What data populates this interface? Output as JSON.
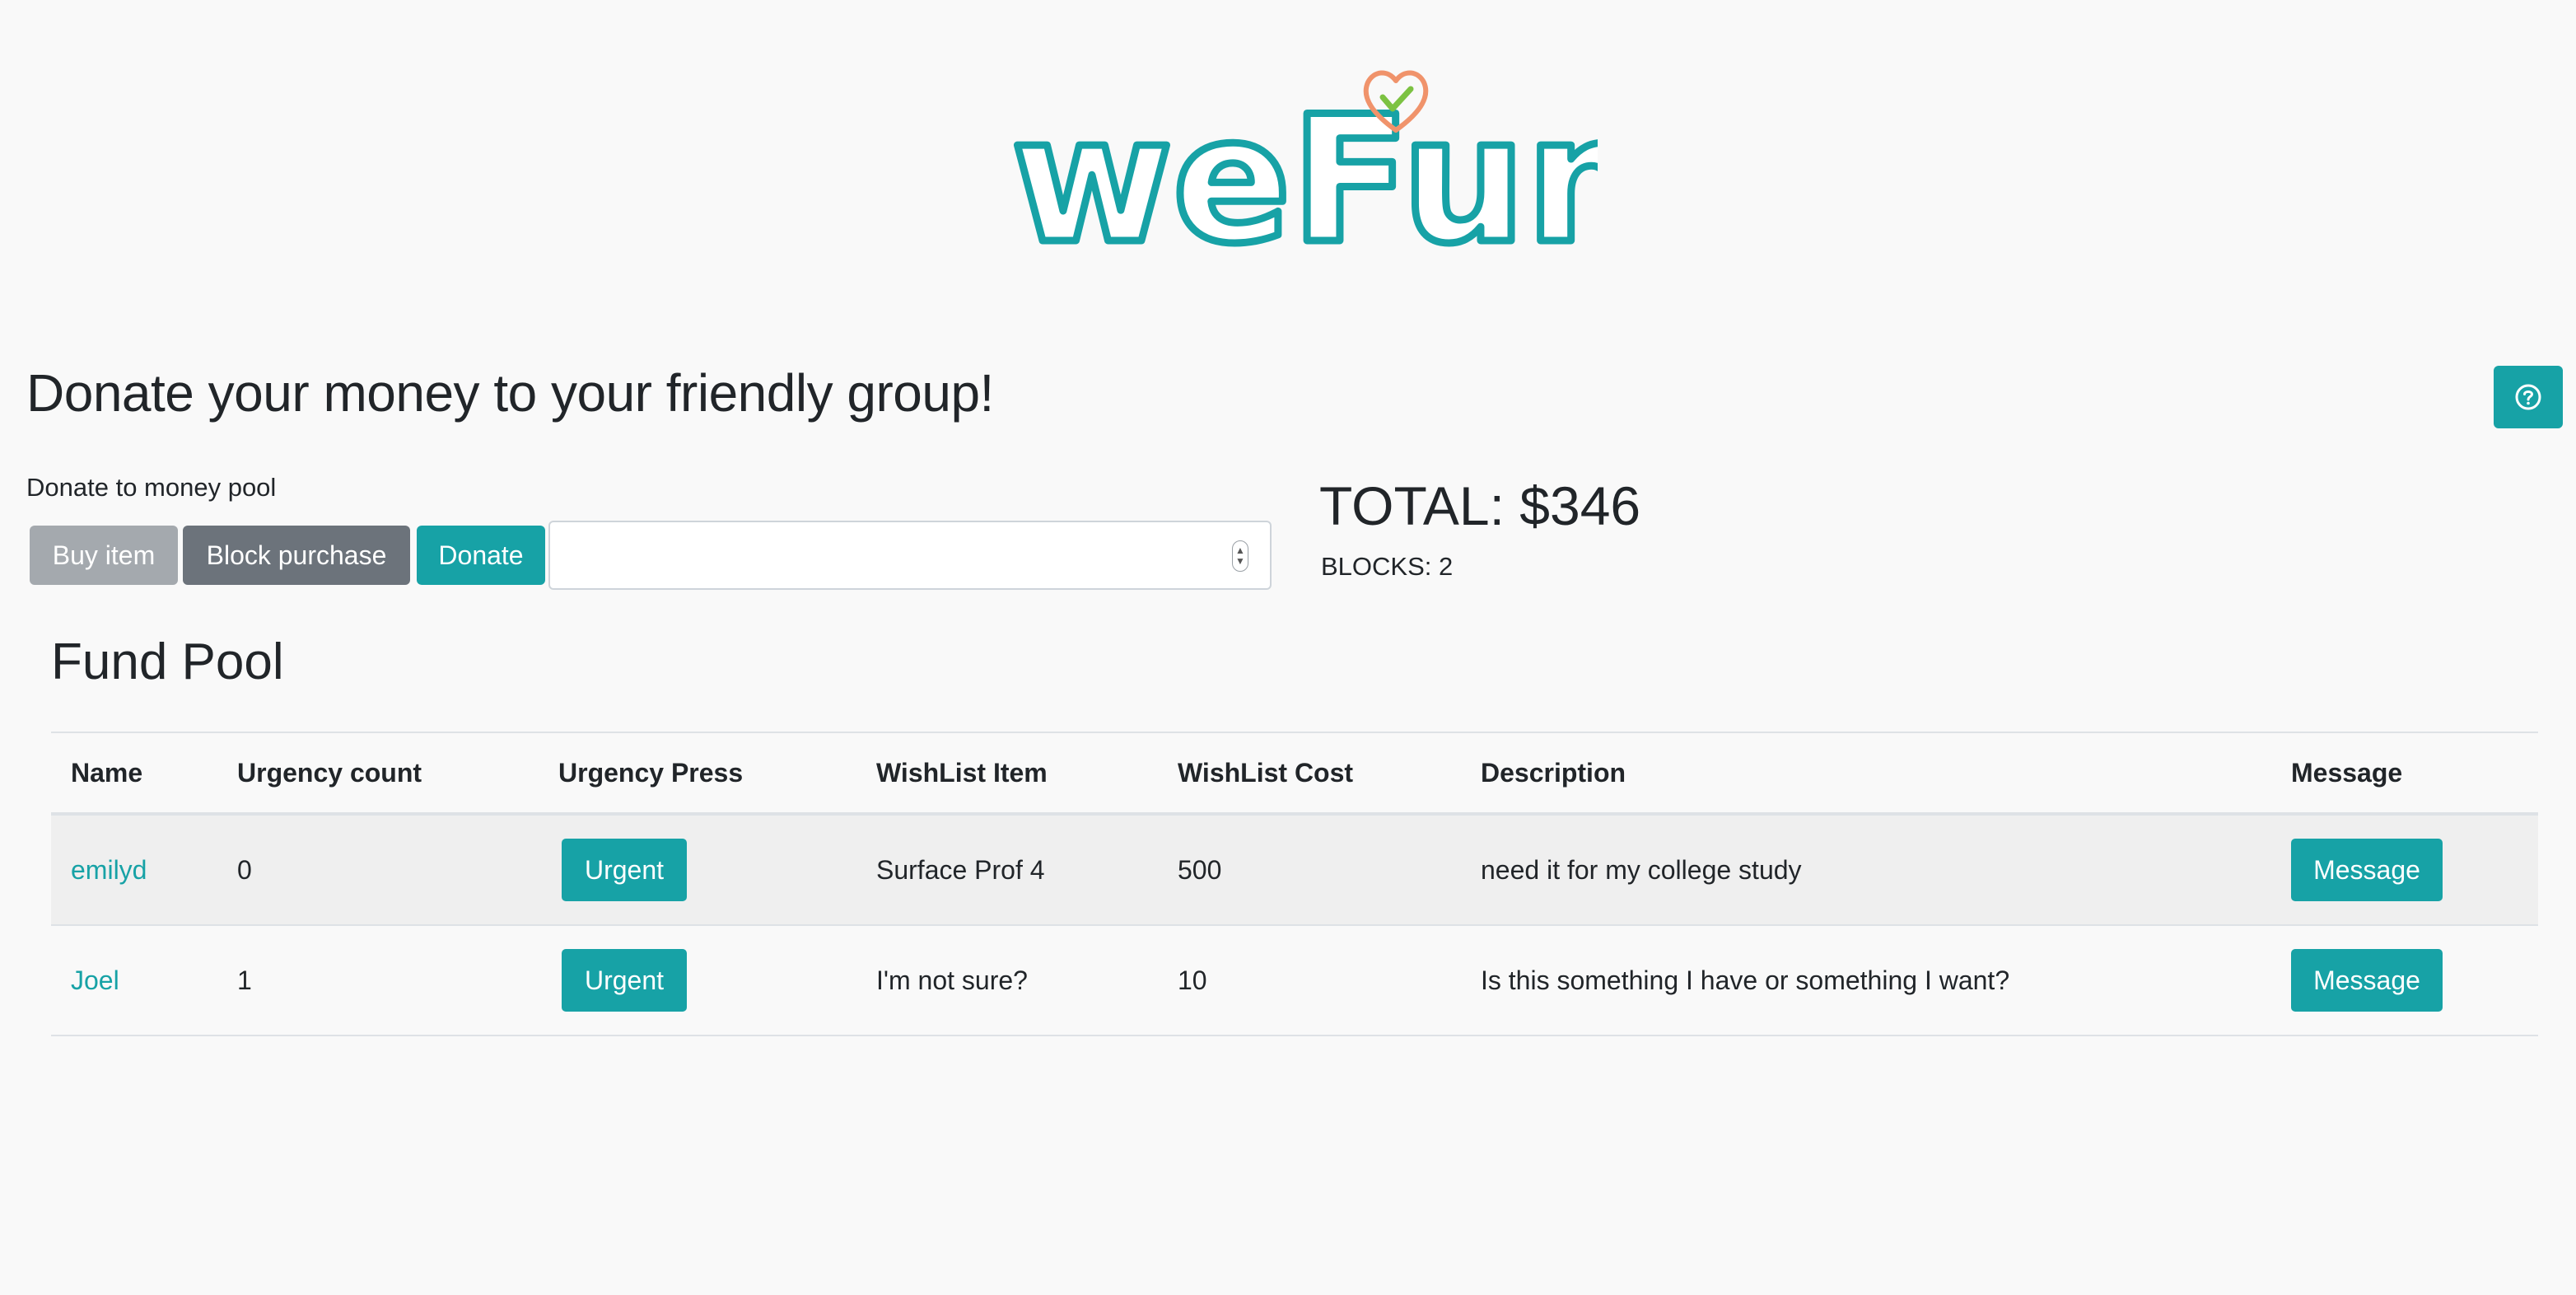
{
  "logo": {
    "text": "weFund",
    "heart_icon": "heart-check-icon"
  },
  "header": {
    "title": "Donate your money to your friendly group!",
    "help_icon": "question-circle-icon"
  },
  "donate": {
    "label": "Donate to money pool",
    "buy_label": "Buy item",
    "block_label": "Block purchase",
    "donate_label": "Donate",
    "amount_value": ""
  },
  "summary": {
    "total": "TOTAL: $346",
    "blocks": "BLOCKS: 2"
  },
  "pool": {
    "title": "Fund Pool",
    "columns": [
      "Name",
      "Urgency count",
      "Urgency Press",
      "WishList Item",
      "WishList Cost",
      "Description",
      "Message"
    ],
    "rows": [
      {
        "name": "emilyd",
        "urgency_count": "0",
        "urgent_label": "Urgent",
        "item": "Surface Prof 4",
        "cost": "500",
        "description": "need it for my college study",
        "message_label": "Message"
      },
      {
        "name": "Joel",
        "urgency_count": "1",
        "urgent_label": "Urgent",
        "item": "I'm not sure?",
        "cost": "10",
        "description": "Is this something I have or something I want?",
        "message_label": "Message"
      }
    ]
  },
  "colors": {
    "accent": "#17a2a6",
    "secondary": "#6c737b",
    "disabled": "#a4a9ae",
    "heart": "#f0936b",
    "check": "#7cc242",
    "background": "#f9f9f9"
  }
}
